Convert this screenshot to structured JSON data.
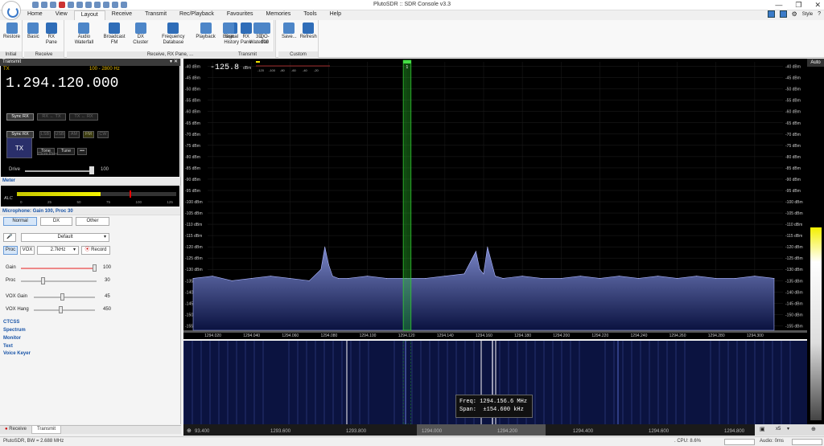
{
  "titlebar": {
    "title": "PlutoSDR :: SDR Console v3.3",
    "minimize": "—",
    "maximize": "❐",
    "close": "✕"
  },
  "menu": {
    "tabs": [
      "Home",
      "View",
      "Layout",
      "Receive",
      "Transmit",
      "Rec/Playback",
      "Favourites",
      "Memories",
      "Tools",
      "Help"
    ],
    "active": "Layout",
    "style_label": "Style"
  },
  "ribbon": {
    "groups": [
      {
        "label": "Initial",
        "buttons": [
          "Restore"
        ]
      },
      {
        "label": "Receive",
        "buttons": [
          "Basic",
          "RX Pane"
        ]
      },
      {
        "label": "Receive, RX Pane, ...",
        "buttons": [
          "Audio Waterfall",
          "Broadcast FM",
          "DX Cluster",
          "Frequency Database",
          "Playback",
          "Signal History",
          "3D Waterfall"
        ]
      },
      {
        "label": "Transmit",
        "buttons": [
          "Basic",
          "RX Pane",
          "QO-100"
        ]
      },
      {
        "label": "Custom",
        "buttons": [
          "Save...",
          "Refresh"
        ]
      }
    ]
  },
  "transmit": {
    "header": "Transmit",
    "tag": "TX",
    "range": "100 - 2800 Hz",
    "frequency": "1.294.120.000",
    "row1": [
      "Sync RX",
      "RX ← TX",
      "TX ← RX"
    ],
    "row2": [
      "Sync RX",
      "LSB",
      "USB",
      "AM",
      "FM",
      "CW"
    ],
    "tx_label": "TX",
    "tone": "Tone",
    "tune": "Tune",
    "more": "•••",
    "sub": "23cm Proc",
    "drive_label": "Drive",
    "drive_value": "100",
    "drive_level": 1.0
  },
  "meter": {
    "header": "Meter",
    "alc": "ALC",
    "scale": [
      "0",
      "25",
      "50",
      "75",
      "100",
      "125"
    ],
    "level": 0.5
  },
  "microphone": {
    "header": "Microphone: Gain 100, Proc 30",
    "modes": [
      "Normal",
      "DX",
      "Other"
    ],
    "mode_selected": "Normal",
    "preset": "Default",
    "proc": "Proc",
    "vox": "VOX",
    "bandwidth": "2.7kHz",
    "record": "Record",
    "gain_label": "Gain",
    "gain_value": "100",
    "gain_level": 1.0,
    "proc_label": "Proc",
    "proc_value": "30",
    "proc_level": 0.3,
    "voxgain_label": "VOX Gain",
    "voxgain_value": "45",
    "voxgain_level": 0.45,
    "voxhang_label": "VOX Hang",
    "voxhang_value": "450",
    "voxhang_level": 0.45
  },
  "sections": [
    "CTCSS",
    "Spectrum",
    "Monitor",
    "Text",
    "Voice Keyer"
  ],
  "bottom_tabs": [
    "Receive",
    "Transmit"
  ],
  "bottom_active": "Transmit",
  "spectrum": {
    "level_readout": "-125.8",
    "level_unit": "dBm",
    "scale_labels": [
      "-120",
      "-100",
      "-80",
      "-60",
      "-40",
      "-20"
    ],
    "y_labels": [
      "-40 dBm",
      "-45 dBm",
      "-50 dBm",
      "-55 dBm",
      "-60 dBm",
      "-65 dBm",
      "-70 dBm",
      "-75 dBm",
      "-80 dBm",
      "-85 dBm",
      "-90 dBm",
      "-95 dBm",
      "-100 dBm",
      "-105 dBm",
      "-110 dBm",
      "-115 dBm",
      "-120 dBm",
      "-125 dBm",
      "-130 dBm",
      "-135 dBm",
      "-140 dBm",
      "-145 dBm",
      "-150 dBm",
      "-155 dBm"
    ],
    "x_labels": [
      "1294.020",
      "1294.040",
      "1294.060",
      "1294.080",
      "1294.100",
      "1294.120",
      "1294.140",
      "1294.160",
      "1294.180",
      "1294.200",
      "1294.220",
      "1294.240",
      "1294.260",
      "1294.280",
      "1294.300"
    ],
    "marker": "1",
    "auto": "Auto"
  },
  "waterfall": {
    "x_labels": [
      "93.400",
      "1293.600",
      "1293.800",
      "1294.000",
      "1294.200",
      "1294.400",
      "1294.600",
      "1294.800"
    ],
    "zoom": "x5",
    "tooltip_freq_label": "Freq:",
    "tooltip_freq": "1294.156.6 MHz",
    "tooltip_span_label": "Span:",
    "tooltip_span": "±154.600 kHz"
  },
  "status": {
    "left": "PlutoSDR, BW = 2.688 MHz",
    "cpu": ". CPU: 8.6%",
    "audio": "Audio: 0ms"
  },
  "chart_data": {
    "type": "line",
    "title": "",
    "xlabel": "",
    "ylabel": "",
    "xlim": [
      1294.005,
      1294.315
    ],
    "ylim": [
      -157,
      -38
    ],
    "x": [
      1294.01,
      1294.02,
      1294.03,
      1294.04,
      1294.05,
      1294.06,
      1294.07,
      1294.076,
      1294.078,
      1294.08,
      1294.082,
      1294.085,
      1294.09,
      1294.1,
      1294.11,
      1294.12,
      1294.13,
      1294.14,
      1294.15,
      1294.156,
      1294.158,
      1294.16,
      1294.162,
      1294.166,
      1294.17,
      1294.18,
      1294.19,
      1294.2,
      1294.21,
      1294.22,
      1294.23,
      1294.24,
      1294.25,
      1294.26,
      1294.27,
      1294.28,
      1294.29,
      1294.3,
      1294.31
    ],
    "series": [
      {
        "values": [
          -134,
          -133,
          -135,
          -134,
          -133,
          -134,
          -135,
          -130,
          -120,
          -128,
          -133,
          -134,
          -134,
          -133,
          -134,
          -134,
          -134,
          -133,
          -132,
          -122,
          -130,
          -132,
          -120,
          -133,
          -134,
          -133,
          -134,
          -134,
          -133,
          -134,
          -133,
          -134,
          -133,
          -134,
          -133,
          -134,
          -134,
          -133,
          -134
        ]
      }
    ],
    "passband": [
      1294.1185,
      1294.1225
    ]
  }
}
